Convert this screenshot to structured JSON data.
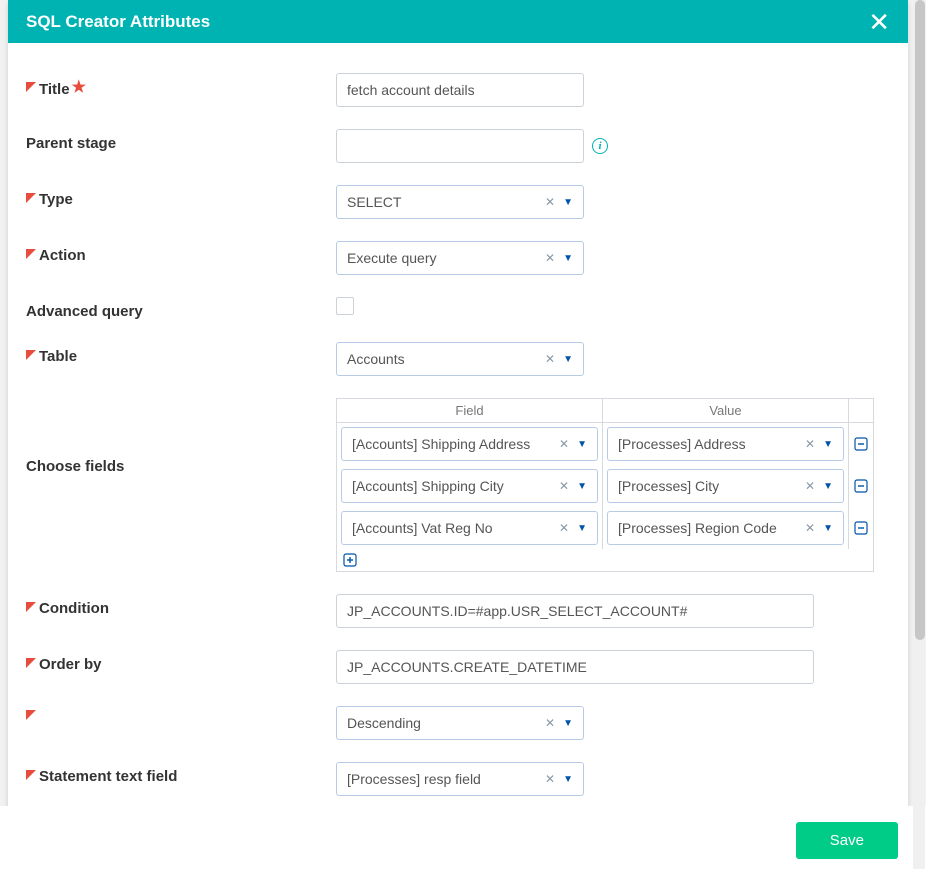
{
  "header": {
    "title": "SQL Creator Attributes"
  },
  "labels": {
    "title": "Title",
    "parent_stage": "Parent stage",
    "type": "Type",
    "action": "Action",
    "advanced_query": "Advanced query",
    "table": "Table",
    "choose_fields": "Choose fields",
    "condition": "Condition",
    "order_by": "Order by",
    "order_dir": "",
    "statement_text_field": "Statement text field"
  },
  "values": {
    "title": "fetch account details",
    "parent_stage": "",
    "type": "SELECT",
    "action": "Execute query",
    "table": "Accounts",
    "condition": "JP_ACCOUNTS.ID=#app.USR_SELECT_ACCOUNT#",
    "order_by": "JP_ACCOUNTS.CREATE_DATETIME",
    "order_dir": "Descending",
    "statement_text_field": "[Processes] resp field"
  },
  "fields_table": {
    "head_field": "Field",
    "head_value": "Value",
    "rows": [
      {
        "field": "[Accounts] Shipping Address",
        "value": "[Processes] Address"
      },
      {
        "field": "[Accounts] Shipping City",
        "value": "[Processes] City"
      },
      {
        "field": "[Accounts] Vat Reg No",
        "value": "[Processes] Region Code"
      }
    ]
  },
  "footer": {
    "save": "Save"
  }
}
